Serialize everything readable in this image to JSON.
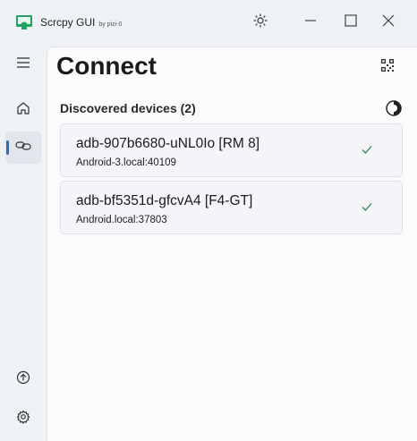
{
  "window": {
    "title": "Scrcpy GUI",
    "byline": "by pizi-0",
    "icon": "app-logo-icon",
    "controls": [
      "theme-toggle-icon",
      "minimize-icon",
      "maximize-icon",
      "close-icon"
    ]
  },
  "nav": {
    "items": [
      {
        "id": "menu",
        "icon": "hamburger-menu-icon"
      },
      {
        "id": "home",
        "icon": "home-icon"
      },
      {
        "id": "connect",
        "icon": "link-icon",
        "selected": true
      },
      {
        "id": "update",
        "icon": "upload-icon"
      },
      {
        "id": "settings",
        "icon": "gear-icon"
      }
    ]
  },
  "page": {
    "title": "Connect",
    "qr_icon": "qr-code-icon",
    "section_label": "Discovered devices (2)",
    "loading_icon": "loading-spinner-icon"
  },
  "devices": [
    {
      "name": "adb-907b6680-uNL0Io [RM 8]",
      "address": "Android-3.local:40109",
      "status_icon": "checkmark-icon"
    },
    {
      "name": "adb-bf5351d-gfcvA4 [F4-GT]",
      "address": "Android.local:37803",
      "status_icon": "checkmark-icon"
    }
  ],
  "colors": {
    "accent": "#1a73c8",
    "check": "#2e8b57",
    "logo": "#1fa463",
    "window_bg": "#eef1f5",
    "content_bg": "#fbfbfc",
    "card_bg": "#f3f5f9"
  }
}
